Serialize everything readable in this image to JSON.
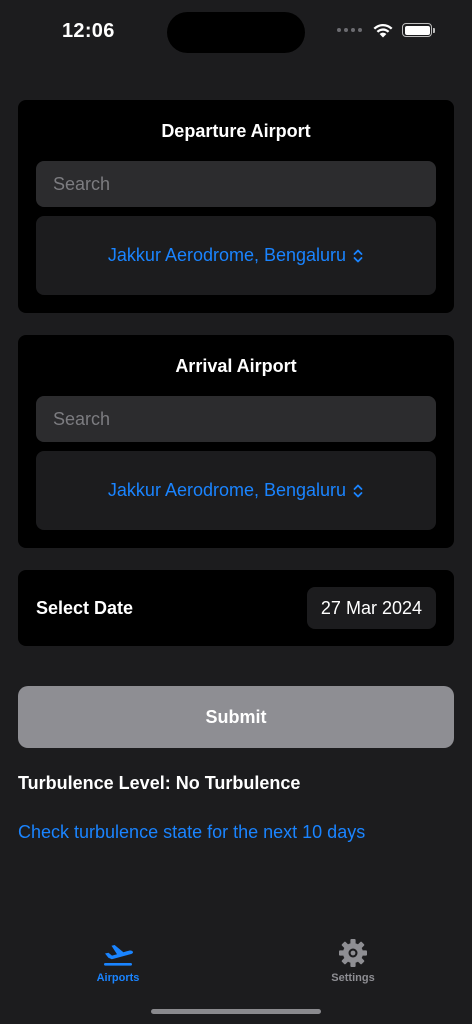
{
  "status_bar": {
    "time": "12:06"
  },
  "departure": {
    "title": "Departure Airport",
    "search_placeholder": "Search",
    "selected_airport": "Jakkur Aerodrome, Bengaluru"
  },
  "arrival": {
    "title": "Arrival Airport",
    "search_placeholder": "Search",
    "selected_airport": "Jakkur Aerodrome, Bengaluru"
  },
  "date": {
    "label": "Select Date",
    "value": "27 Mar 2024"
  },
  "submit_label": "Submit",
  "turbulence_level": "Turbulence Level: No Turbulence",
  "check_link": "Check turbulence state for the next 10 days",
  "tab_bar": {
    "tabs": [
      {
        "label": "Airports",
        "icon": "airplane-departure-icon",
        "active": true
      },
      {
        "label": "Settings",
        "icon": "gear-icon",
        "active": false
      }
    ]
  },
  "colors": {
    "accent": "#1a84ff",
    "background": "#1c1c1e",
    "card": "#000000",
    "field": "#2c2c2e",
    "submit_disabled": "#8e8e93",
    "inactive_tab": "#8e8e93"
  }
}
